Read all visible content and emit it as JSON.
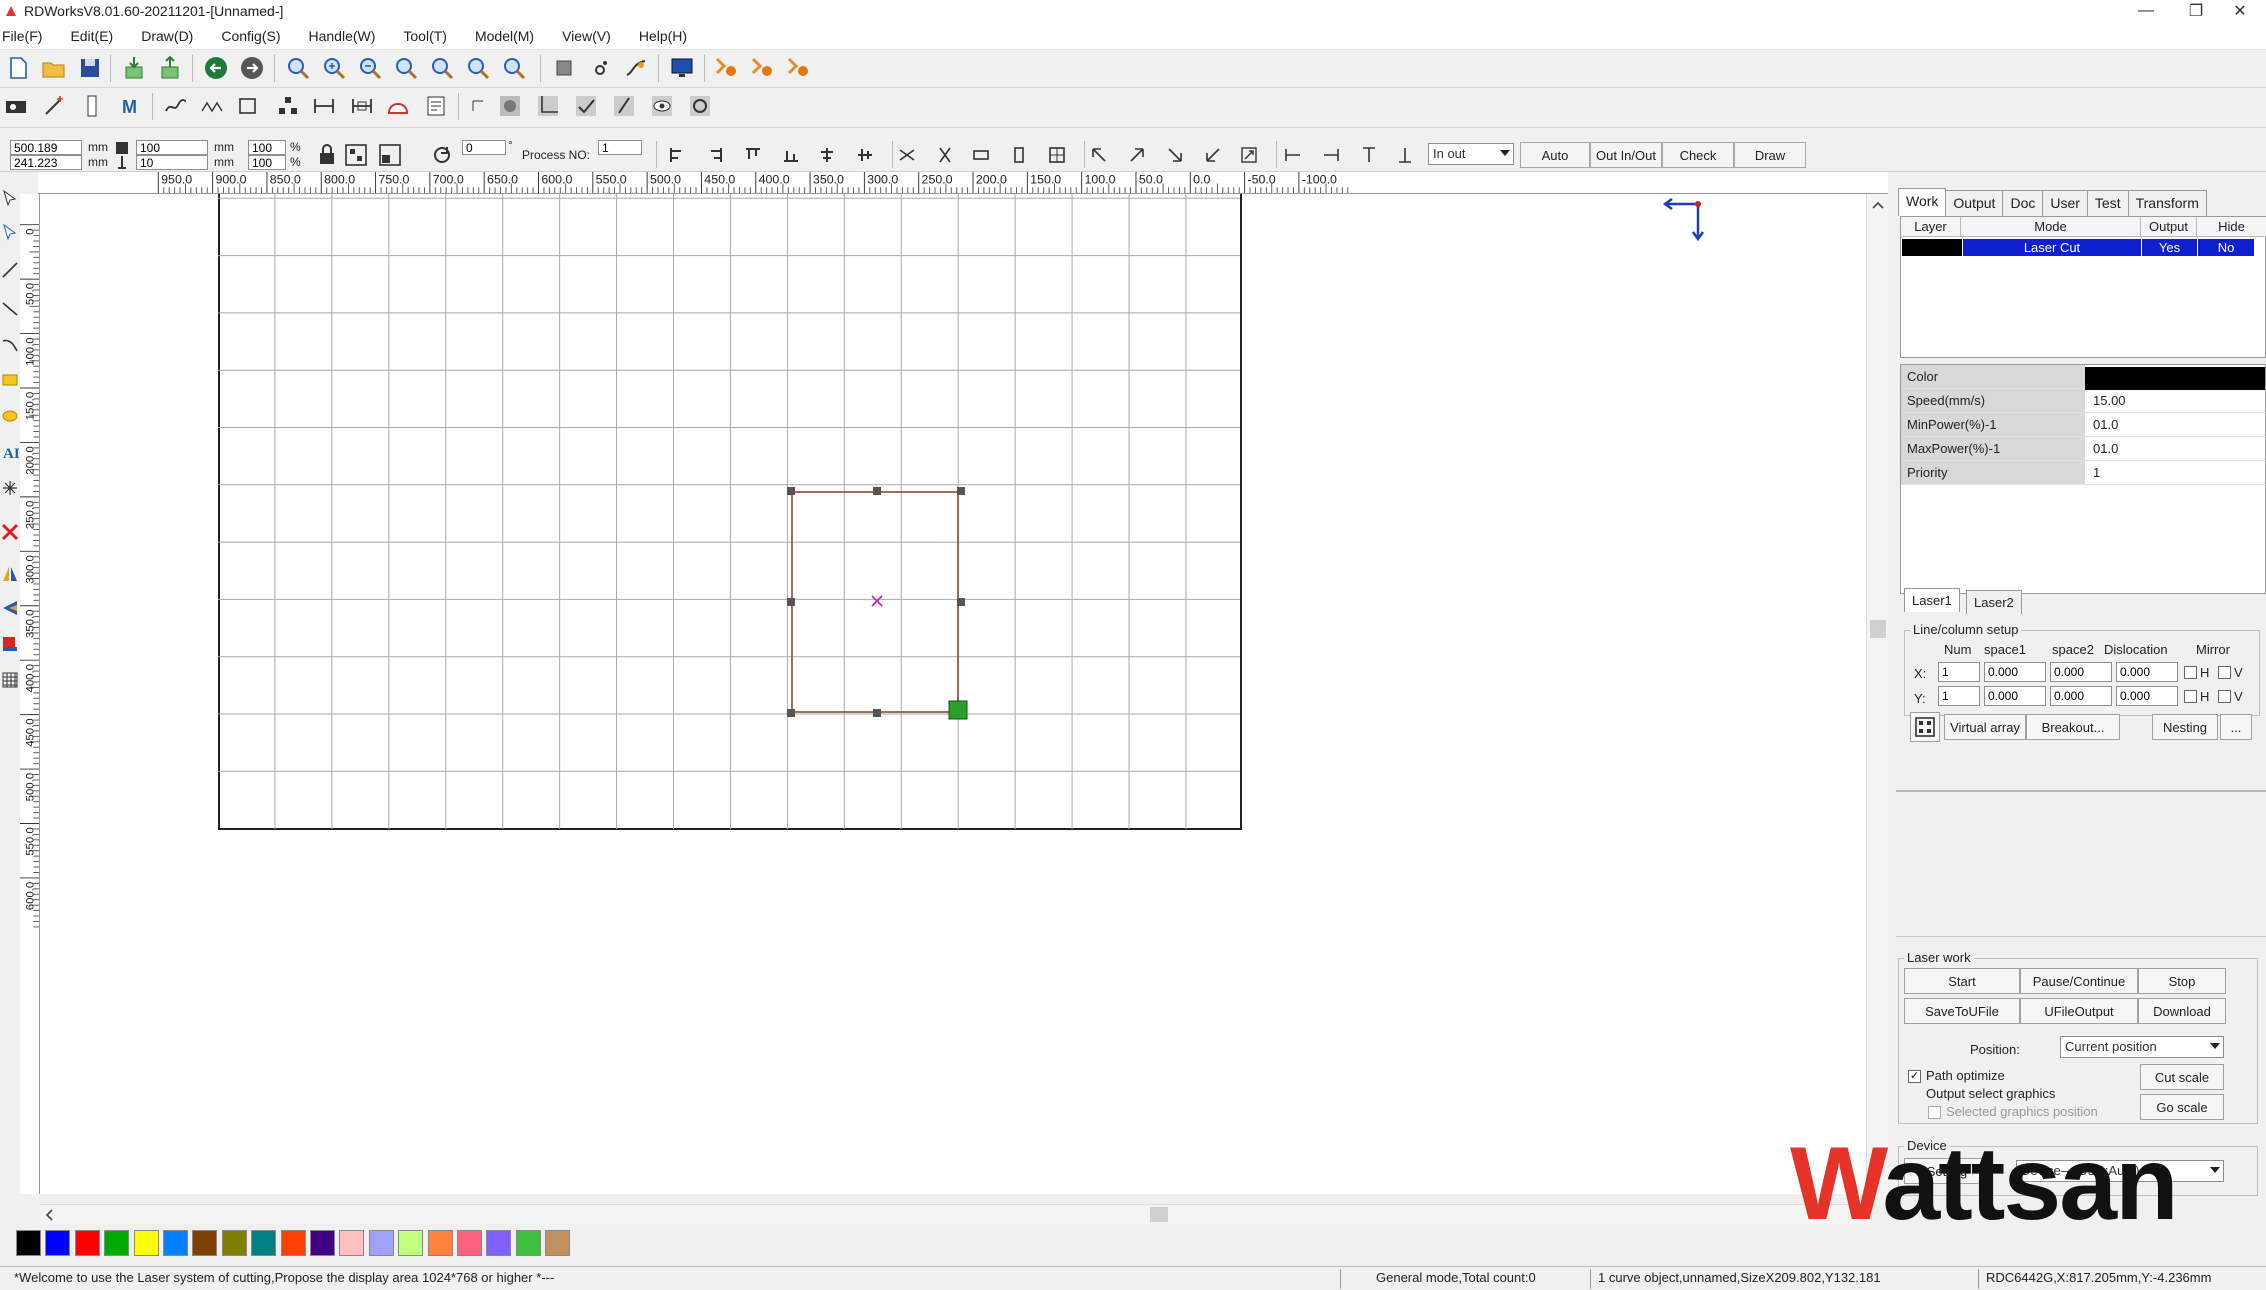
{
  "window": {
    "title": "RDWorksV8.01.60-20211201-[Unnamed-]",
    "minimize": "—",
    "maximize": "❐",
    "close": "✕"
  },
  "menu": [
    "File(F)",
    "Edit(E)",
    "Draw(D)",
    "Config(S)",
    "Handle(W)",
    "Tool(T)",
    "Model(M)",
    "View(V)",
    "Help(H)"
  ],
  "toolbar1_icons": [
    "new-file-icon",
    "open-folder-icon",
    "save-icon",
    "import-icon",
    "export-icon",
    "undo-icon",
    "redo-icon",
    "zoom-icon",
    "zoom-in-icon",
    "zoom-out-icon",
    "zoom-fit-icon",
    "zoom-page-icon",
    "zoom-select-icon",
    "zoom-window-icon",
    "frame-icon",
    "node-icon",
    "path-edit-icon",
    "monitor-icon",
    "laser-1-icon",
    "laser-2-icon",
    "laser-3-icon"
  ],
  "toolbar2_icons": [
    "camera-icon",
    "magic-wand-icon",
    "ruler-icon",
    "text-m-icon",
    "curve-icon",
    "polyline-icon",
    "rectangle-select-icon",
    "array-icon",
    "dimension-icon",
    "offset-icon",
    "cut-icon",
    "chart-icon",
    "select-icon",
    "bitmap-icon",
    "crop-icon",
    "check-icon",
    "sweep-icon",
    "eye-icon",
    "settings-icon"
  ],
  "props": {
    "x_pos": "500.189",
    "y_pos": "241.223",
    "unit": "mm",
    "width": "100",
    "height": "10",
    "w_scale": "100",
    "h_scale": "100",
    "percent": "%",
    "rotate": "0",
    "degree": "°",
    "process_label": "Process NO:",
    "process_no": "1",
    "mode_select": "In out",
    "auto_btn": "Auto",
    "outinout_btn": "Out In/Out",
    "check_btn": "Check",
    "draw_btn": "Draw"
  },
  "ruler": {
    "h_labels": [
      "950.0",
      "900.0",
      "850.0",
      "800.0",
      "750.0",
      "700.0",
      "650.0",
      "600.0",
      "550.0",
      "500.0",
      "450.0",
      "400.0",
      "350.0",
      "300.0",
      "250.0",
      "200.0",
      "150.0",
      "100.0",
      "50.0",
      "0.0",
      "-50.0",
      "-100.0"
    ],
    "v_labels": [
      "0",
      "50.0",
      "100.0",
      "150.0",
      "200.0",
      "250.0",
      "300.0",
      "350.0",
      "400.0",
      "450.0",
      "500.0",
      "550.0",
      "600.0"
    ]
  },
  "palette": [
    "#000000",
    "#0000ff",
    "#ff0000",
    "#00aa00",
    "#ffff00",
    "#0080ff",
    "#804000",
    "#808000",
    "#008080",
    "#ff4000",
    "#400080",
    "#ffc0c0",
    "#a0a0ff",
    "#c0ff80",
    "#ff8040",
    "#ff6080",
    "#8060ff",
    "#40c040",
    "#c09060"
  ],
  "status": {
    "welcome": "*Welcome to use the Laser system of cutting,Propose the display area 1024*768 or higher *---",
    "mode": "General mode,Total count:0",
    "object": "1 curve object,unnamed,SizeX209.802,Y132.181",
    "device": "RDC6442G,X:817.205mm,Y:-4.236mm"
  },
  "panel": {
    "tabs": [
      "Work",
      "Output",
      "Doc",
      "User",
      "Test",
      "Transform"
    ],
    "layer_headers": [
      "Layer",
      "Mode",
      "Output",
      "Hide"
    ],
    "layer_row": {
      "mode": "Laser Cut",
      "output": "Yes",
      "hide": "No",
      "color": "#000000"
    },
    "props": [
      {
        "k": "Color",
        "v": ""
      },
      {
        "k": "Speed(mm/s)",
        "v": "15.00"
      },
      {
        "k": "MinPower(%)-1",
        "v": "01.0"
      },
      {
        "k": "MaxPower(%)-1",
        "v": "01.0"
      },
      {
        "k": "Priority",
        "v": "1"
      }
    ],
    "laser_tabs": [
      "Laser1",
      "Laser2"
    ],
    "array_title": "Line/column setup",
    "array_headers": [
      "Num",
      "space1",
      "space2",
      "Dislocation",
      "Mirror"
    ],
    "row_x": {
      "label": "X:",
      "num": "1",
      "s1": "0.000",
      "s2": "0.000",
      "dis": "0.000"
    },
    "row_y": {
      "label": "Y:",
      "num": "1",
      "s1": "0.000",
      "s2": "0.000",
      "dis": "0.000"
    },
    "mirror_h": "H",
    "mirror_v": "V",
    "virtual_array": "Virtual array",
    "breakout": "Breakout...",
    "nesting": "Nesting",
    "more": "...",
    "laserwork_title": "Laser work",
    "start": "Start",
    "pause": "Pause/Continue",
    "stop": "Stop",
    "savetofile": "SaveToUFile",
    "ufileoutput": "UFileOutput",
    "download": "Download",
    "position_label": "Position:",
    "position_value": "Current position",
    "path_optimize": "Path optimize",
    "output_select": "Output select graphics",
    "selected_pos": "Selected graphics position",
    "cut_scale": "Cut scale",
    "go_scale": "Go scale",
    "device_title": "Device",
    "setting": "Setting",
    "device_value": "Device—(USB:Auto)"
  },
  "watermark": {
    "w": "W",
    "rest": "attsan"
  }
}
